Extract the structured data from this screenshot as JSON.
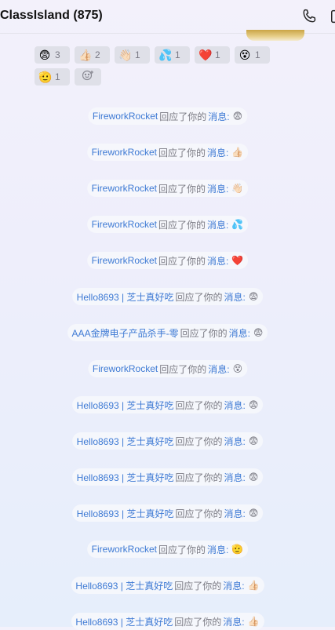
{
  "header": {
    "title": "ClassIsland (875)",
    "icons": [
      "phone-icon",
      "more-icon"
    ]
  },
  "reactions": [
    {
      "emoji": "😨",
      "count": "3"
    },
    {
      "emoji": "👍🏻",
      "count": "2"
    },
    {
      "emoji": "👋🏻",
      "count": "1"
    },
    {
      "emoji": "💦",
      "count": "1"
    },
    {
      "emoji": "❤️",
      "count": "1"
    },
    {
      "emoji": "😵",
      "count": "1"
    },
    {
      "emoji": "🫡",
      "count": "1"
    }
  ],
  "add_reaction_icon": "add-emoji-icon",
  "notices": [
    {
      "user": "FireworkRocket",
      "action": "回应了你的",
      "msg": "消息:",
      "emoji": "😨"
    },
    {
      "user": "FireworkRocket",
      "action": "回应了你的",
      "msg": "消息:",
      "emoji": "👍🏻"
    },
    {
      "user": "FireworkRocket",
      "action": "回应了你的",
      "msg": "消息:",
      "emoji": "👋🏻"
    },
    {
      "user": "FireworkRocket",
      "action": "回应了你的",
      "msg": "消息:",
      "emoji": "💦"
    },
    {
      "user": "FireworkRocket",
      "action": "回应了你的",
      "msg": "消息:",
      "emoji": "❤️"
    },
    {
      "user": "Hello8693 | 芝士真好吃",
      "action": "回应了你的",
      "msg": "消息:",
      "emoji": "😨"
    },
    {
      "user": "AAA金牌电子产品杀手-零",
      "action": "回应了你的",
      "msg": "消息:",
      "emoji": "😨"
    },
    {
      "user": "FireworkRocket",
      "action": "回应了你的",
      "msg": "消息:",
      "emoji": "😵"
    },
    {
      "user": "Hello8693 | 芝士真好吃",
      "action": "回应了你的",
      "msg": "消息:",
      "emoji": "😨"
    },
    {
      "user": "Hello8693 | 芝士真好吃",
      "action": "回应了你的",
      "msg": "消息:",
      "emoji": "😨"
    },
    {
      "user": "Hello8693 | 芝士真好吃",
      "action": "回应了你的",
      "msg": "消息:",
      "emoji": "😨"
    },
    {
      "user": "Hello8693 | 芝士真好吃",
      "action": "回应了你的",
      "msg": "消息:",
      "emoji": "😨"
    },
    {
      "user": "FireworkRocket",
      "action": "回应了你的",
      "msg": "消息:",
      "emoji": "🫡"
    },
    {
      "user": "Hello8693 | 芝士真好吃",
      "action": "回应了你的",
      "msg": "消息:",
      "emoji": "👍🏻"
    },
    {
      "user": "Hello8693 | 芝士真好吃",
      "action": "回应了你的",
      "msg": "消息:",
      "emoji": "👍🏻"
    }
  ]
}
